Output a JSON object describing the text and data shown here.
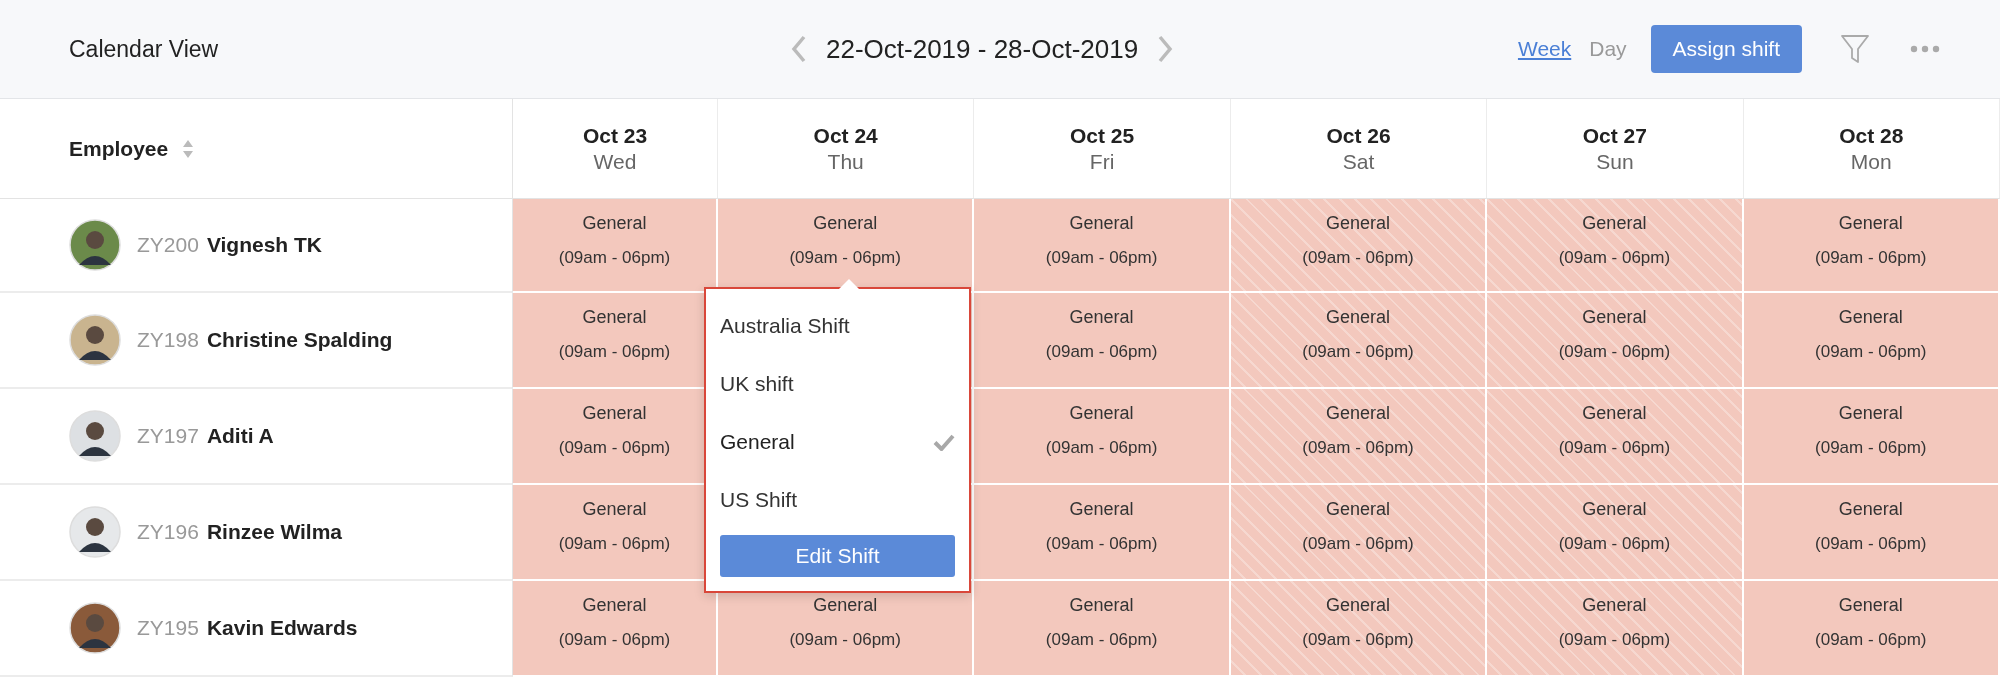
{
  "header": {
    "title": "Calendar View",
    "date_range": "22-Oct-2019 - 28-Oct-2019",
    "views": [
      {
        "label": "Week",
        "selected": true
      },
      {
        "label": "Day",
        "selected": false
      }
    ],
    "assign_button": "Assign shift"
  },
  "table": {
    "employee_column": "Employee",
    "days": [
      {
        "date": "Oct 23",
        "weekday": "Wed",
        "weekend": false
      },
      {
        "date": "Oct 24",
        "weekday": "Thu",
        "weekend": false
      },
      {
        "date": "Oct 25",
        "weekday": "Fri",
        "weekend": false
      },
      {
        "date": "Oct 26",
        "weekday": "Sat",
        "weekend": true
      },
      {
        "date": "Oct 27",
        "weekday": "Sun",
        "weekend": true
      },
      {
        "date": "Oct 28",
        "weekday": "Mon",
        "weekend": false
      }
    ],
    "rows": [
      {
        "id": "ZY200",
        "name": "Vignesh TK",
        "cells": [
          {
            "shift": "General",
            "time": "(09am - 06pm)"
          },
          {
            "shift": "General",
            "time": "(09am - 06pm)"
          },
          {
            "shift": "General",
            "time": "(09am - 06pm)"
          },
          {
            "shift": "General",
            "time": "(09am - 06pm)"
          },
          {
            "shift": "General",
            "time": "(09am - 06pm)"
          },
          {
            "shift": "General",
            "time": "(09am - 06pm)"
          }
        ]
      },
      {
        "id": "ZY198",
        "name": "Christine Spalding",
        "cells": [
          {
            "shift": "General",
            "time": "(09am - 06pm)"
          },
          null,
          {
            "shift": "General",
            "time": "(09am - 06pm)"
          },
          {
            "shift": "General",
            "time": "(09am - 06pm)"
          },
          {
            "shift": "General",
            "time": "(09am - 06pm)"
          },
          {
            "shift": "General",
            "time": "(09am - 06pm)"
          }
        ]
      },
      {
        "id": "ZY197",
        "name": "Aditi A",
        "cells": [
          {
            "shift": "General",
            "time": "(09am - 06pm)"
          },
          null,
          {
            "shift": "General",
            "time": "(09am - 06pm)"
          },
          {
            "shift": "General",
            "time": "(09am - 06pm)"
          },
          {
            "shift": "General",
            "time": "(09am - 06pm)"
          },
          {
            "shift": "General",
            "time": "(09am - 06pm)"
          }
        ]
      },
      {
        "id": "ZY196",
        "name": "Rinzee Wilma",
        "cells": [
          {
            "shift": "General",
            "time": "(09am - 06pm)"
          },
          null,
          {
            "shift": "General",
            "time": "(09am - 06pm)"
          },
          {
            "shift": "General",
            "time": "(09am - 06pm)"
          },
          {
            "shift": "General",
            "time": "(09am - 06pm)"
          },
          {
            "shift": "General",
            "time": "(09am - 06pm)"
          }
        ]
      },
      {
        "id": "ZY195",
        "name": "Kavin Edwards",
        "cells": [
          {
            "shift": "General",
            "time": "(09am - 06pm)"
          },
          {
            "shift": "General",
            "time": "(09am - 06pm)"
          },
          {
            "shift": "General",
            "time": "(09am - 06pm)"
          },
          {
            "shift": "General",
            "time": "(09am - 06pm)"
          },
          {
            "shift": "General",
            "time": "(09am - 06pm)"
          },
          {
            "shift": "General",
            "time": "(09am - 06pm)"
          }
        ]
      }
    ]
  },
  "shift_menu": {
    "options": [
      {
        "label": "Australia Shift",
        "selected": false
      },
      {
        "label": "UK shift",
        "selected": false
      },
      {
        "label": "General",
        "selected": true
      },
      {
        "label": "US Shift",
        "selected": false
      }
    ],
    "button": "Edit Shift"
  }
}
